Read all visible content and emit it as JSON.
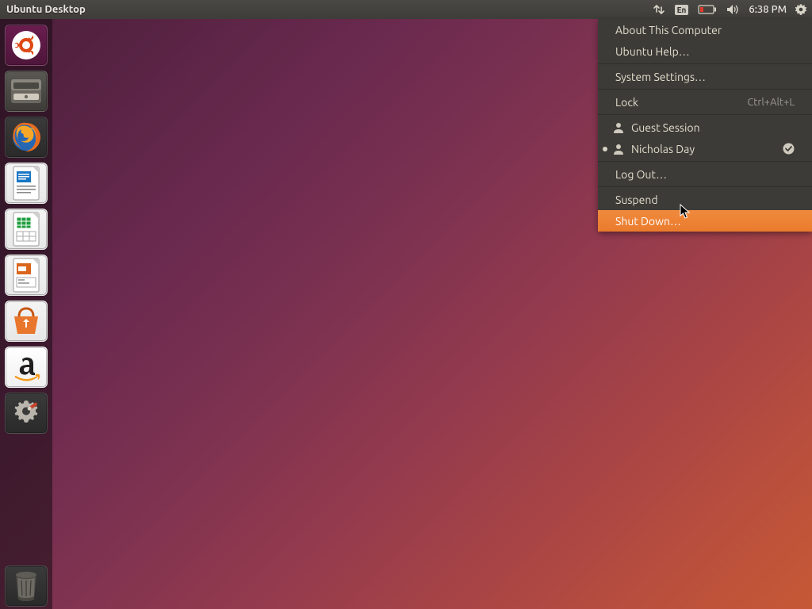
{
  "panel": {
    "title": "Ubuntu Desktop",
    "keyboard_indicator": "En",
    "time": "6:38 PM"
  },
  "launcher": {
    "items": [
      {
        "name": "dash",
        "label": "Dash"
      },
      {
        "name": "files",
        "label": "Files"
      },
      {
        "name": "firefox",
        "label": "Firefox"
      },
      {
        "name": "writer",
        "label": "LibreOffice Writer"
      },
      {
        "name": "calc",
        "label": "LibreOffice Calc"
      },
      {
        "name": "impress",
        "label": "LibreOffice Impress"
      },
      {
        "name": "software",
        "label": "Ubuntu Software"
      },
      {
        "name": "amazon",
        "label": "Amazon"
      },
      {
        "name": "settings",
        "label": "System Settings"
      }
    ],
    "trash_label": "Trash"
  },
  "system_menu": {
    "about": "About This Computer",
    "help": "Ubuntu Help…",
    "settings": "System Settings…",
    "lock": "Lock",
    "lock_shortcut": "Ctrl+Alt+L",
    "guest": "Guest Session",
    "user": "Nicholas Day",
    "logout": "Log Out…",
    "suspend": "Suspend",
    "shutdown": "Shut Down…"
  }
}
